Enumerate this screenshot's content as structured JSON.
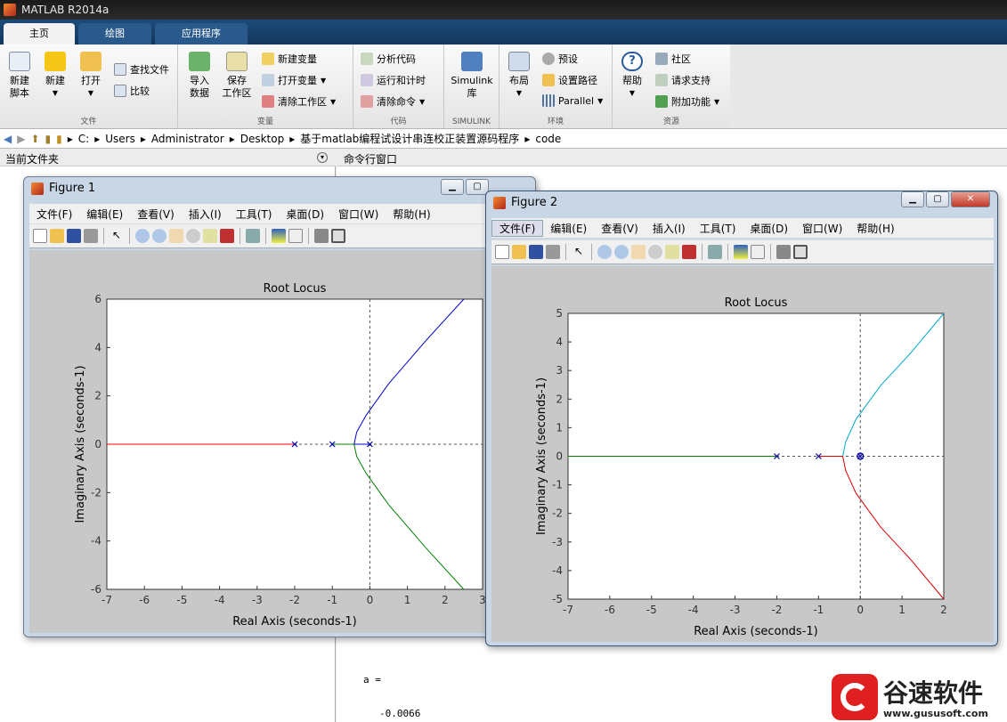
{
  "app_title": "MATLAB R2014a",
  "tabs": [
    "主页",
    "绘图",
    "应用程序"
  ],
  "ribbon": {
    "file": {
      "new_script": "新建\n脚本",
      "new": "新建",
      "open": "打开",
      "find_files": "查找文件",
      "compare": "比较",
      "label": "文件"
    },
    "variable": {
      "import": "导入\n数据",
      "save": "保存\n工作区",
      "new_var": "新建变量",
      "open_var": "打开变量",
      "clear_ws": "清除工作区",
      "label": "变量"
    },
    "code": {
      "analyze": "分析代码",
      "run_time": "运行和计时",
      "clear_cmd": "清除命令",
      "label": "代码"
    },
    "simulink": {
      "lib": "Simulink\n库",
      "label": "SIMULINK"
    },
    "env": {
      "layout": "布局",
      "prefs": "预设",
      "set_path": "设置路径",
      "parallel": "Parallel",
      "label": "环境"
    },
    "resources": {
      "help": "帮助",
      "community": "社区",
      "support": "请求支持",
      "addons": "附加功能",
      "label": "资源"
    }
  },
  "address": [
    "C:",
    "Users",
    "Administrator",
    "Desktop",
    "基于matlab编程试设计串连校正装置源码程序",
    "code"
  ],
  "left_pane_title": "当前文件夹",
  "cmd_pane_title": "命令行窗口",
  "cmd_output": [
    "a =",
    "-0.0066"
  ],
  "menu_items": [
    "文件(F)",
    "编辑(E)",
    "查看(V)",
    "插入(I)",
    "工具(T)",
    "桌面(D)",
    "窗口(W)",
    "帮助(H)"
  ],
  "figure1": {
    "title": "Figure 1"
  },
  "figure2": {
    "title": "Figure 2"
  },
  "watermark": {
    "brand": "谷速软件",
    "url": "www.gususoft.com"
  },
  "chart_data": [
    {
      "type": "line",
      "title": "Root Locus",
      "xlabel": "Real Axis (seconds-1)",
      "ylabel": "Imaginary Axis (seconds-1)",
      "xlim": [
        -7,
        3
      ],
      "ylim": [
        -6,
        6
      ],
      "xticks": [
        -7,
        -6,
        -5,
        -4,
        -3,
        -2,
        -1,
        0,
        1,
        2,
        3
      ],
      "yticks": [
        -6,
        -4,
        -2,
        0,
        2,
        4,
        6
      ],
      "poles": [
        [
          -2,
          0
        ],
        [
          -1,
          0
        ],
        [
          0,
          0
        ]
      ],
      "series": [
        {
          "color": "#ff0000",
          "points": [
            [
              -7,
              0
            ],
            [
              -2,
              0
            ]
          ]
        },
        {
          "color": "#0000cc",
          "points": [
            [
              -0.42,
              0
            ],
            [
              -0.35,
              0.5
            ],
            [
              -0.1,
              1.2
            ],
            [
              0.5,
              2.5
            ],
            [
              1.5,
              4.3
            ],
            [
              2.5,
              6
            ]
          ]
        },
        {
          "color": "#008000",
          "points": [
            [
              -0.42,
              0
            ],
            [
              -0.35,
              -0.5
            ],
            [
              -0.1,
              -1.2
            ],
            [
              0.5,
              -2.5
            ],
            [
              1.5,
              -4.3
            ],
            [
              2.5,
              -6
            ]
          ]
        },
        {
          "color": "#008000",
          "points": [
            [
              -1,
              0
            ],
            [
              -0.42,
              0
            ]
          ]
        },
        {
          "color": "#0000cc",
          "points": [
            [
              0,
              0
            ],
            [
              -0.42,
              0
            ]
          ]
        }
      ]
    },
    {
      "type": "line",
      "title": "Root Locus",
      "xlabel": "Real Axis (seconds-1)",
      "ylabel": "Imaginary Axis (seconds-1)",
      "xlim": [
        -7,
        2
      ],
      "ylim": [
        -5,
        5
      ],
      "xticks": [
        -7,
        -6,
        -5,
        -4,
        -3,
        -2,
        -1,
        0,
        1,
        2
      ],
      "yticks": [
        -5,
        -4,
        -3,
        -2,
        -1,
        0,
        1,
        2,
        3,
        4,
        5
      ],
      "poles": [
        [
          -2,
          0
        ],
        [
          -1,
          0
        ],
        [
          0,
          0
        ]
      ],
      "zeros": [
        [
          0,
          0
        ]
      ],
      "series": [
        {
          "color": "#008000",
          "points": [
            [
              -7,
              0
            ],
            [
              -2,
              0
            ]
          ]
        },
        {
          "color": "#00aacc",
          "points": [
            [
              -0.42,
              0
            ],
            [
              -0.35,
              0.5
            ],
            [
              -0.1,
              1.3
            ],
            [
              0.5,
              2.5
            ],
            [
              1.2,
              3.6
            ],
            [
              2,
              5
            ]
          ]
        },
        {
          "color": "#dd0000",
          "points": [
            [
              -0.42,
              0
            ],
            [
              -0.35,
              -0.5
            ],
            [
              -0.1,
              -1.3
            ],
            [
              0.5,
              -2.5
            ],
            [
              1.2,
              -3.6
            ],
            [
              2,
              -5
            ]
          ]
        },
        {
          "color": "#dd0000",
          "points": [
            [
              -1,
              0
            ],
            [
              -0.42,
              0
            ]
          ]
        }
      ]
    }
  ]
}
